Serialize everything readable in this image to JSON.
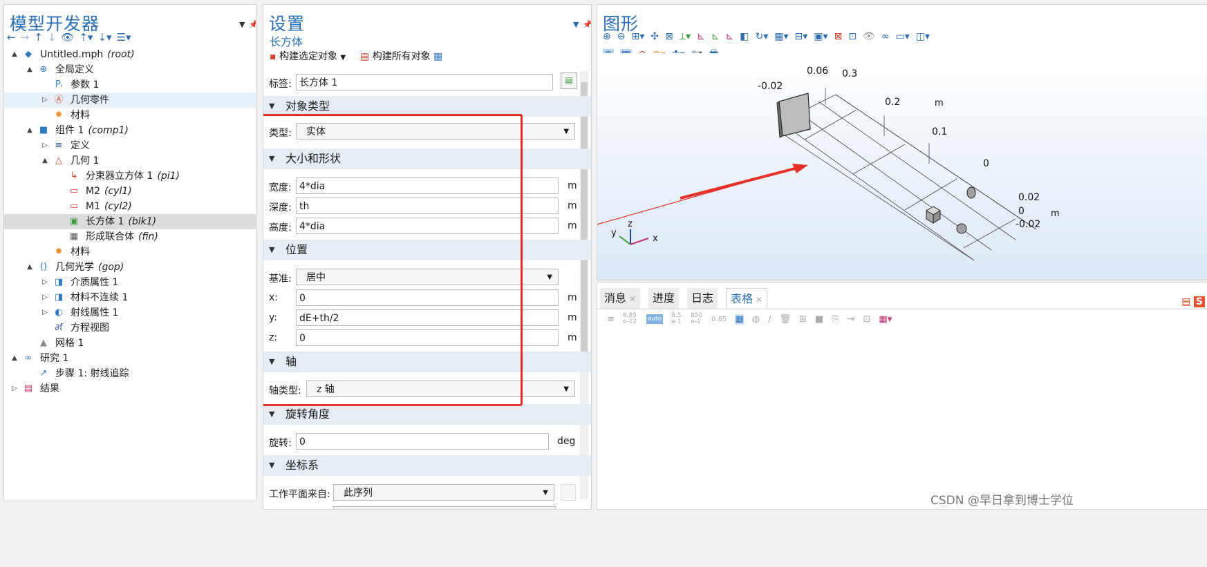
{
  "model_builder": {
    "title": "模型开发器",
    "tree": [
      {
        "label": "Untitled.mph",
        "tag": "(root)",
        "level": 0,
        "arrow": "▲",
        "icon": "◆",
        "iconColor": "#2f78c4",
        "name": "tree-item-root",
        "state": ""
      },
      {
        "label": "全局定义",
        "tag": "",
        "level": 1,
        "arrow": "▲",
        "icon": "⊕",
        "iconColor": "#2f78c4",
        "name": "tree-item-global-definitions",
        "state": ""
      },
      {
        "label": "参数 1",
        "tag": "",
        "level": 2,
        "arrow": "",
        "icon": "Pᵢ",
        "iconColor": "#2f78c4",
        "name": "tree-item-parameters-1",
        "state": ""
      },
      {
        "label": "几何零件",
        "tag": "",
        "level": 2,
        "arrow": "▷",
        "icon": "Ⓐ",
        "iconColor": "#d0432c",
        "name": "tree-item-geometry-parts",
        "state": "sel"
      },
      {
        "label": "材料",
        "tag": "",
        "level": 2,
        "arrow": "",
        "icon": "✹",
        "iconColor": "#e8902a",
        "name": "tree-item-materials-global",
        "state": ""
      },
      {
        "label": "组件 1",
        "tag": "(comp1)",
        "level": 1,
        "arrow": "▲",
        "icon": "■",
        "iconColor": "#2f78c4",
        "name": "tree-item-component-1",
        "state": ""
      },
      {
        "label": "定义",
        "tag": "",
        "level": 2,
        "arrow": "▷",
        "icon": "≡",
        "iconColor": "#2f5a9e",
        "name": "tree-item-definitions",
        "state": ""
      },
      {
        "label": "几何 1",
        "tag": "",
        "level": 2,
        "arrow": "▲",
        "icon": "△",
        "iconColor": "#d0432c",
        "name": "tree-item-geometry-1",
        "state": ""
      },
      {
        "label": "分束器立方体 1",
        "tag": "(pi1)",
        "level": 3,
        "arrow": "",
        "icon": "↳",
        "iconColor": "#d0432c",
        "name": "tree-item-beam-splitter-cube",
        "state": ""
      },
      {
        "label": "M2",
        "tag": "(cyl1)",
        "level": 3,
        "arrow": "",
        "icon": "▭",
        "iconColor": "#d0432c",
        "name": "tree-item-m2",
        "state": ""
      },
      {
        "label": "M1",
        "tag": "(cyl2)",
        "level": 3,
        "arrow": "",
        "icon": "▭",
        "iconColor": "#d0432c",
        "name": "tree-item-m1",
        "state": ""
      },
      {
        "label": "长方体 1",
        "tag": "(blk1)",
        "level": 3,
        "arrow": "",
        "icon": "▣",
        "iconColor": "#3a9a3a",
        "name": "tree-item-block-1",
        "state": "hl"
      },
      {
        "label": "形成联合体",
        "tag": "(fin)",
        "level": 3,
        "arrow": "",
        "icon": "▦",
        "iconColor": "#555",
        "name": "tree-item-form-union",
        "state": ""
      },
      {
        "label": "材料",
        "tag": "",
        "level": 2,
        "arrow": "",
        "icon": "✹",
        "iconColor": "#e8902a",
        "name": "tree-item-materials",
        "state": ""
      },
      {
        "label": "几何光学",
        "tag": "(gop)",
        "level": 1,
        "arrow": "▲",
        "icon": "()",
        "iconColor": "#2f78c4",
        "name": "tree-item-geometrical-optics",
        "state": ""
      },
      {
        "label": "介质属性 1",
        "tag": "",
        "level": 2,
        "arrow": "▷",
        "icon": "◨",
        "iconColor": "#2f78c4",
        "name": "tree-item-medium-properties",
        "state": ""
      },
      {
        "label": "材料不连续 1",
        "tag": "",
        "level": 2,
        "arrow": "▷",
        "icon": "◨",
        "iconColor": "#2f78c4",
        "name": "tree-item-material-discontinuity",
        "state": ""
      },
      {
        "label": "射线属性 1",
        "tag": "",
        "level": 2,
        "arrow": "▷",
        "icon": "◐",
        "iconColor": "#2f78c4",
        "name": "tree-item-ray-properties",
        "state": ""
      },
      {
        "label": "方程视图",
        "tag": "",
        "level": 2,
        "arrow": "",
        "icon": "∂f",
        "iconColor": "#2f5a9e",
        "name": "tree-item-equation-view",
        "state": ""
      },
      {
        "label": "网格 1",
        "tag": "",
        "level": 1,
        "arrow": "",
        "icon": "▲",
        "iconColor": "#888",
        "name": "tree-item-mesh-1",
        "state": ""
      },
      {
        "label": "研究 1",
        "tag": "",
        "level": 0,
        "arrow": "▲",
        "icon": "∞",
        "iconColor": "#2f78c4",
        "name": "tree-item-study-1",
        "state": ""
      },
      {
        "label": "步骤 1: 射线追踪",
        "tag": "",
        "level": 1,
        "arrow": "",
        "icon": "↗",
        "iconColor": "#2f78c4",
        "name": "tree-item-step-1-ray-tracing",
        "state": ""
      },
      {
        "label": "结果",
        "tag": "",
        "level": 0,
        "arrow": "▷",
        "icon": "▤",
        "iconColor": "#c03070",
        "name": "tree-item-results",
        "state": ""
      }
    ]
  },
  "settings": {
    "title": "设置",
    "subtitle": "长方体",
    "build_selected": "构建选定对象",
    "build_all": "构建所有对象",
    "label_field": {
      "label": "标签:",
      "value": "长方体 1"
    },
    "sections": {
      "object_type": "对象类型",
      "size_shape": "大小和形状",
      "position": "位置",
      "axis": "轴",
      "rotation": "旋转角度",
      "coordinate_system": "坐标系"
    },
    "type": {
      "label": "类型:",
      "value": "实体"
    },
    "width": {
      "label": "宽度:",
      "value": "4*dia",
      "unit": "m"
    },
    "depth": {
      "label": "深度:",
      "value": "th",
      "unit": "m"
    },
    "height": {
      "label": "高度:",
      "value": "4*dia",
      "unit": "m"
    },
    "base": {
      "label": "基准:",
      "value": "居中"
    },
    "x": {
      "label": "x:",
      "value": "0",
      "unit": "m"
    },
    "y": {
      "label": "y:",
      "value": "dE+th/2",
      "unit": "m"
    },
    "z": {
      "label": "z:",
      "value": "0",
      "unit": "m"
    },
    "axis_type": {
      "label": "轴类型:",
      "value": "z 轴"
    },
    "rotation": {
      "label": "旋转:",
      "value": "0",
      "unit": "deg"
    },
    "workplane": {
      "label": "工作平面来自:",
      "value": "此序列"
    }
  },
  "graphics": {
    "title": "图形",
    "axis_labels": {
      "top_006": "0.06",
      "top_03": "0.3",
      "top_m002": "-0.02",
      "top_02": "0.2",
      "top_m": "m",
      "top_01": "0.1",
      "top_0": "0",
      "r_002": "0.02",
      "r_0": "0",
      "r_m": "m",
      "r_m002": "-0.02"
    },
    "triad": {
      "x": "x",
      "y": "y",
      "z": "z"
    },
    "colors": {
      "arrow": "#e8302a",
      "highlight_box": "#e8302a",
      "bg_top": "#ffffff",
      "bg_bottom": "#dbe8f6"
    }
  },
  "bottom": {
    "tabs": [
      {
        "label": "消息",
        "closable": true,
        "active": false
      },
      {
        "label": "进度",
        "closable": false,
        "active": false
      },
      {
        "label": "日志",
        "closable": false,
        "active": false
      },
      {
        "label": "表格",
        "closable": true,
        "active": true
      }
    ],
    "table_toolbar": [
      "8.85 e-12",
      "8.5 e-1",
      "850 e-1",
      "0.85"
    ]
  },
  "watermark": "CSDN @早日拿到博士学位"
}
